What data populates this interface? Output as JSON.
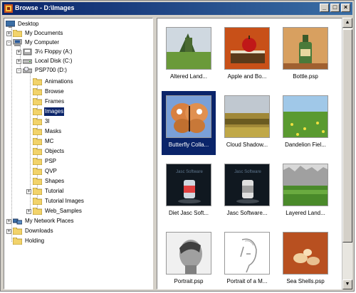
{
  "window": {
    "title": "Browse - D:\\Images"
  },
  "controls": {
    "minimize": "_",
    "maximize": "□",
    "close": "×"
  },
  "tree": [
    {
      "label": "Desktop",
      "icon": "desktop-icon"
    },
    {
      "label": "My Documents",
      "icon": "folder-icon"
    },
    {
      "label": "My Computer",
      "icon": "computer-icon"
    },
    {
      "label": "3½ Floppy (A:)",
      "icon": "floppy-icon"
    },
    {
      "label": "Local Disk (C:)",
      "icon": "drive-icon"
    },
    {
      "label": "PSP700 (D:)",
      "icon": "cd-icon"
    },
    {
      "label": "Animations",
      "icon": "folder-icon"
    },
    {
      "label": "Browse",
      "icon": "folder-icon"
    },
    {
      "label": "Frames",
      "icon": "folder-icon"
    },
    {
      "label": "Images",
      "icon": "folder-icon"
    },
    {
      "label": "3I",
      "icon": "folder-icon"
    },
    {
      "label": "Masks",
      "icon": "folder-icon"
    },
    {
      "label": "MC",
      "icon": "folder-icon"
    },
    {
      "label": "Objects",
      "icon": "folder-icon"
    },
    {
      "label": "PSP",
      "icon": "folder-icon"
    },
    {
      "label": "QVP",
      "icon": "folder-icon"
    },
    {
      "label": "Shapes",
      "icon": "folder-icon"
    },
    {
      "label": "Tutorial",
      "icon": "folder-icon"
    },
    {
      "label": "Tutorial Images",
      "icon": "folder-icon"
    },
    {
      "label": "Web_Samples",
      "icon": "folder-icon"
    },
    {
      "label": "My Network Places",
      "icon": "network-icon"
    },
    {
      "label": "Downloads",
      "icon": "folder-icon"
    },
    {
      "label": "Holding",
      "icon": "folder-icon"
    }
  ],
  "thumbnails": [
    {
      "caption": "Altered Land...",
      "selected": false
    },
    {
      "caption": "Apple and Bo...",
      "selected": false
    },
    {
      "caption": "Bottle.psp",
      "selected": false
    },
    {
      "caption": "Butterfly Colla...",
      "selected": true
    },
    {
      "caption": "Cloud Shadow...",
      "selected": false
    },
    {
      "caption": "Dandelion Fiel...",
      "selected": false
    },
    {
      "caption": "Diet Jasc Soft...",
      "selected": false
    },
    {
      "caption": "Jasc Software...",
      "selected": false
    },
    {
      "caption": "Layered Land...",
      "selected": false
    },
    {
      "caption": "Portrait.psp",
      "selected": false
    },
    {
      "caption": "Portrait of a M...",
      "selected": false
    },
    {
      "caption": "Sea Shells.psp",
      "selected": false
    }
  ],
  "thumb_images": {
    "jasc_text": "Jasc Software"
  },
  "scrollbar": {
    "up": "▲",
    "down": "▼"
  }
}
